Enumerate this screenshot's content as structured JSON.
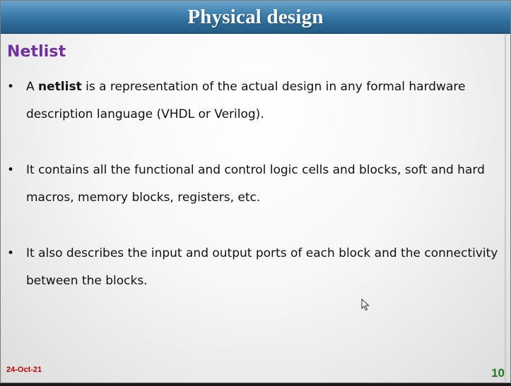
{
  "slide": {
    "title": "Physical design",
    "heading": "Netlist",
    "bullets": [
      {
        "prefix": "A ",
        "bold": "netlist",
        "rest": " is a representation of the actual design in any formal hardware description language (VHDL or Verilog)."
      },
      {
        "text": "It contains all the functional and control logic cells and blocks, soft and hard macros, memory blocks, registers, etc."
      },
      {
        "text": "It also describes the input and output ports of each block and the connectivity between the blocks."
      }
    ],
    "bullet_glyph": "•",
    "footer_date": "24-Oct-21",
    "page_number": "10"
  },
  "icons": {
    "cursor": "mouse-pointer-icon"
  },
  "colors": {
    "title_bar": "#3a78a6",
    "heading": "#7030a0",
    "date": "#c00000",
    "page_number": "#1f7a1f"
  }
}
